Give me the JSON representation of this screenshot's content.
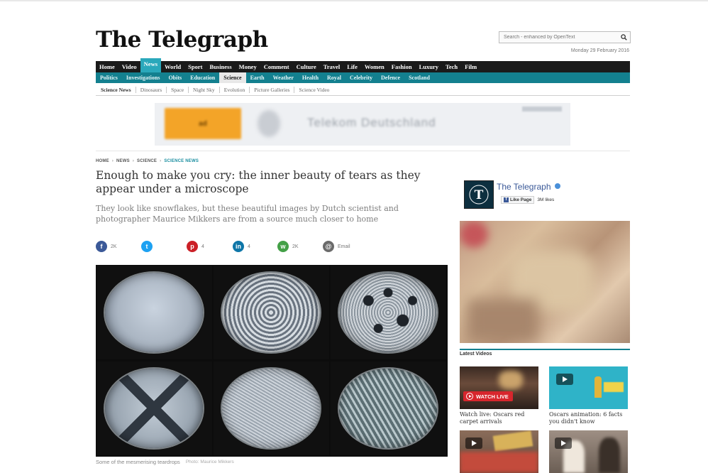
{
  "masthead": {
    "logo": "The Telegraph",
    "search_placeholder": "Search - enhanced by OpenText",
    "date": "Monday 29 February 2016"
  },
  "nav_primary": [
    "Home",
    "Video",
    "News",
    "World",
    "Sport",
    "Business",
    "Money",
    "Comment",
    "Culture",
    "Travel",
    "Life",
    "Women",
    "Fashion",
    "Luxury",
    "Tech",
    "Film"
  ],
  "nav_primary_active": "News",
  "nav_secondary": [
    "Politics",
    "Investigations",
    "Obits",
    "Education",
    "Science",
    "Earth",
    "Weather",
    "Health",
    "Royal",
    "Celebrity",
    "Defence",
    "Scotland"
  ],
  "nav_secondary_active": "Science",
  "nav_tertiary": [
    "Science News",
    "Dinosaurs",
    "Space",
    "Night Sky",
    "Evolution",
    "Picture Galleries",
    "Science Video"
  ],
  "breadcrumb": [
    "HOME",
    "NEWS",
    "SCIENCE",
    "SCIENCE NEWS"
  ],
  "article": {
    "headline": "Enough to make you cry: the inner beauty of tears as they appear under a microscope",
    "standfirst": "They look like snowflakes, but these beautiful images by Dutch scientist and photographer Maurice Mikkers are from a source much closer to home",
    "caption": "Some of the mesmerising teardrops",
    "credit": "Photo: Maurice Mikkers"
  },
  "share": [
    {
      "network": "facebook",
      "icon": "f",
      "count": "2K",
      "color": "#3b5998"
    },
    {
      "network": "twitter",
      "icon": "t",
      "count": "",
      "color": "#1da1f2"
    },
    {
      "network": "pinterest",
      "icon": "p",
      "count": "4",
      "color": "#cb2027"
    },
    {
      "network": "linkedin",
      "icon": "in",
      "count": "4",
      "color": "#0e76a8"
    },
    {
      "network": "whatsapp",
      "icon": "w",
      "count": "2K",
      "color": "#43a047"
    },
    {
      "network": "email",
      "icon": "@",
      "count": "Email",
      "color": "#6b6b6b"
    }
  ],
  "sidebar": {
    "fb_page_title": "The Telegraph",
    "fb_like_label": "Like Page",
    "fb_likes": "3M likes",
    "latest_videos_label": "Latest Videos",
    "videos": [
      {
        "badge": "WATCH LIVE",
        "caption": "Watch live: Oscars red carpet arrivals"
      },
      {
        "badge": "",
        "caption": "Oscars animation: 6 facts you didn't know"
      },
      {
        "badge": "",
        "caption": ""
      },
      {
        "badge": "",
        "caption": ""
      }
    ]
  },
  "ad": {
    "text": "Telekom Deutschland"
  }
}
